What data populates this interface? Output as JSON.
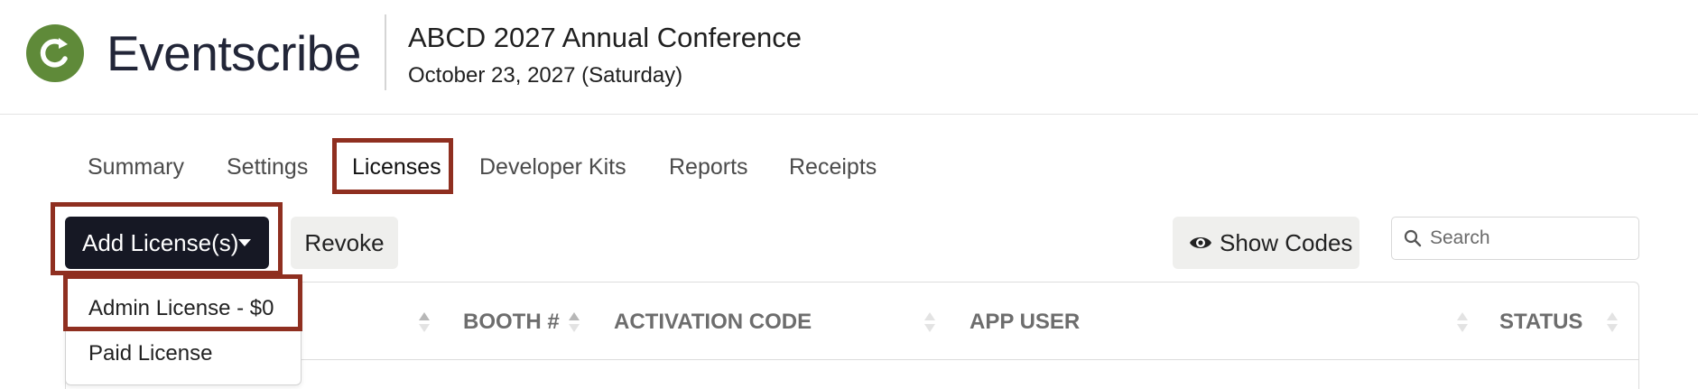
{
  "brand": {
    "name": "Eventscribe",
    "logo_icon": "refresh-c-logo-icon",
    "logo_color": "#5f8a39"
  },
  "event": {
    "title": "ABCD 2027 Annual Conference",
    "date": "October 23, 2027 (Saturday)"
  },
  "tabs": [
    {
      "label": "Summary"
    },
    {
      "label": "Settings"
    },
    {
      "label": "Licenses",
      "active": true
    },
    {
      "label": "Developer Kits"
    },
    {
      "label": "Reports"
    },
    {
      "label": "Receipts"
    }
  ],
  "toolbar": {
    "add_label": "Add License(s)",
    "revoke_label": "Revoke",
    "show_codes_label": "Show Codes",
    "show_codes_icon": "eye-icon",
    "search_placeholder": "Search",
    "search_value": ""
  },
  "dropdown": {
    "items": [
      {
        "label": "Admin License - $0",
        "highlighted": true
      },
      {
        "label": "Paid License"
      }
    ]
  },
  "table": {
    "columns": [
      {
        "label": ""
      },
      {
        "label": "BOOTH #"
      },
      {
        "label": "ACTIVATION CODE"
      },
      {
        "label": "APP USER"
      },
      {
        "label": "STATUS"
      }
    ]
  },
  "colors": {
    "highlight_box": "#8f2f20",
    "primary_button": "#161824",
    "secondary_button": "#efefed"
  }
}
